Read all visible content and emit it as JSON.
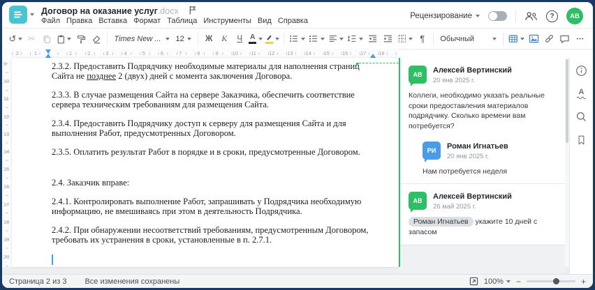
{
  "colors": {
    "accent_teal": "#4BC4D2",
    "comment_green": "#2EBE64",
    "comment_blue": "#4A9BE8",
    "ruler_marker_blue": "#4A9DE8",
    "highlight_yellow": "#F6D243"
  },
  "window": {
    "title": "Договор на оказание услуг",
    "title_ext": ".docx"
  },
  "header": {
    "menu_items": [
      "Файл",
      "Правка",
      "Вставка",
      "Формат",
      "Таблица",
      "Инструменты",
      "Вид",
      "Справка"
    ],
    "review_label": "Рецензирование",
    "avatar_initials": "АВ"
  },
  "toolbar": {
    "font_name": "Times New ...",
    "font_size": "12",
    "bold_label": "Ж",
    "italic_label": "К",
    "underline_label": "Ч",
    "font_color_label": "А",
    "style_name": "Обычный"
  },
  "icons": {
    "undo": "↺",
    "cut": "✂",
    "pilcrow": "¶"
  },
  "ruler": {
    "h_left_numbers": [
      "2",
      "1"
    ],
    "h_numbers": [
      "1",
      "2",
      "3",
      "4",
      "5",
      "6",
      "7",
      "8",
      "9",
      "10",
      "11",
      "12",
      "13",
      "14",
      "15",
      "16",
      "17",
      "18"
    ],
    "v_numbers": [
      "9",
      "10",
      "11",
      "12",
      "13",
      "14",
      "15",
      "16",
      "17",
      "18",
      "19",
      "20"
    ]
  },
  "document": {
    "paragraphs": [
      {
        "segments": [
          {
            "text": "2.3.2. Предоставить Подрядчику необходимые материалы для наполнения страниц Сайта не "
          },
          {
            "text": "позднее",
            "underline": true
          },
          {
            "text": " 2 (двух) дней с момента заключения Договора."
          }
        ]
      },
      {
        "segments": [
          {
            "text": "2.3.3. В случае размещения Сайта на сервере Заказчика, обеспечить соответствие сервера техническим требованиям для размещения Сайта."
          }
        ]
      },
      {
        "segments": [
          {
            "text": "2.3.4. Предоставить Подрядчику доступ к серверу для размещения Сайта и для выполнения Работ, предусмотренных Договором."
          }
        ]
      },
      {
        "segments": [
          {
            "text": "2.3.5. Оплатить результат Работ в порядке и в сроки, предусмотренные Договором."
          }
        ]
      },
      {
        "gap_before": true,
        "segments": [
          {
            "text": "2.4. Заказчик вправе:"
          }
        ]
      },
      {
        "segments": [
          {
            "text": "2.4.1. Контролировать выполнение Работ, запрашивать у Подрядчика необходимую информацию, не вмешиваясь при этом в деятельность Подрядчика."
          }
        ]
      },
      {
        "segments": [
          {
            "text": "2.4.2. При обнаружении несоответствий требованиям, предусмотренным Договором, требовать их устранения в сроки, установленные в п. 2.7.1."
          }
        ]
      }
    ]
  },
  "comments": {
    "items": [
      {
        "initials": "АВ",
        "color": "#2EBE64",
        "name": "Алексей Вертинский",
        "date": "20 янв 2025 г.",
        "text": "Коллеги, необходимо указать реальные сроки предоставления материалов подрядчику. Сколько времени вам потребуется?",
        "reply": false
      },
      {
        "initials": "РИ",
        "color": "#4A9BE8",
        "name": "Роман Игнатьев",
        "date": "20 янв 2025 г.",
        "text": "Нам потребуется неделя",
        "reply": true
      },
      {
        "initials": "АВ",
        "color": "#2EBE64",
        "name": "Алексей Вертинский",
        "date": "26 май 2025 г.",
        "mention": "Роман Игнатьев",
        "text": "укажите 10 дней с запасом",
        "reply": false,
        "divider_before": true
      }
    ]
  },
  "statusbar": {
    "page_info": "Страница 2 из 3",
    "saved_info": "Все изменения сохранены",
    "zoom_value": "100%"
  }
}
